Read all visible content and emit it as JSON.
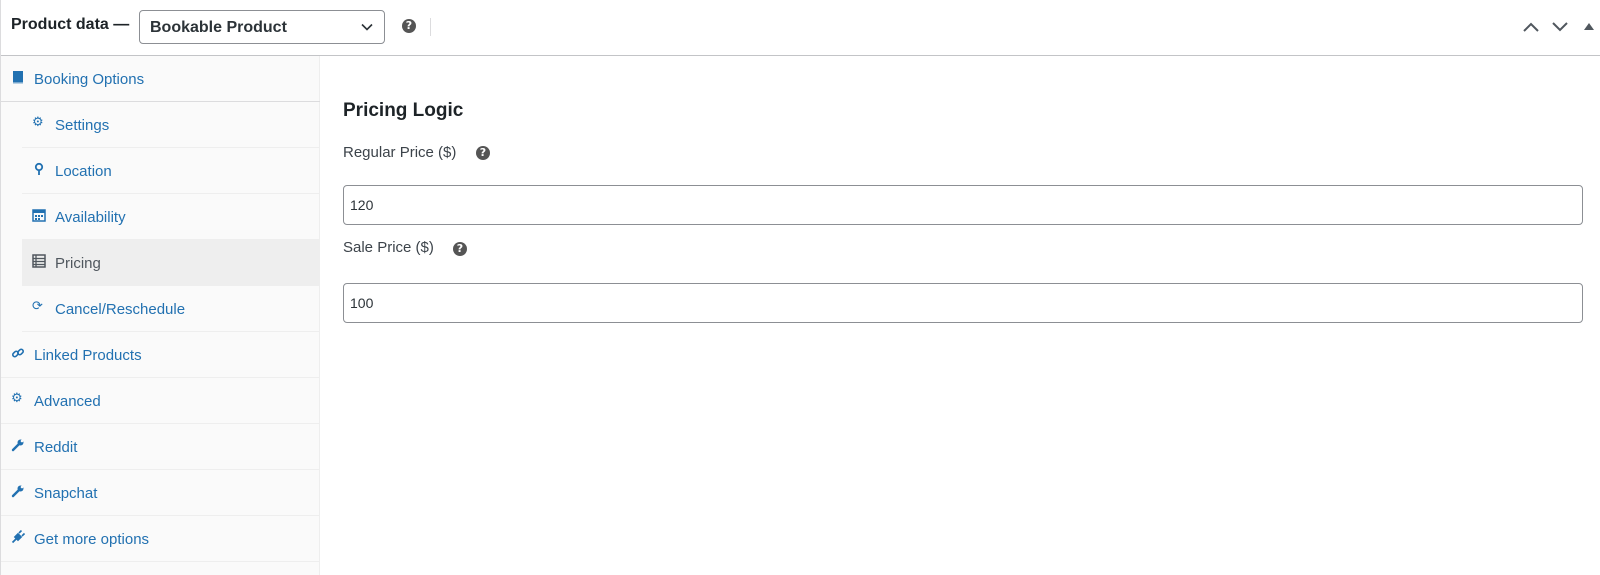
{
  "header": {
    "title": "Product data —",
    "product_type": {
      "selected": "Bookable Product"
    },
    "help_icon": "help-icon",
    "controls": [
      "chevron-up-icon",
      "chevron-down-icon",
      "collapse-arrow-icon"
    ]
  },
  "sidebar": {
    "items": [
      {
        "label": "Booking Options",
        "icon": "book-icon"
      },
      {
        "label": "Settings",
        "icon": "gear-icon"
      },
      {
        "label": "Location",
        "icon": "map-pin-icon"
      },
      {
        "label": "Availability",
        "icon": "calendar-icon"
      },
      {
        "label": "Pricing",
        "icon": "pricing-table-icon",
        "active": true
      },
      {
        "label": "Cancel/Reschedule",
        "icon": "refresh-icon"
      },
      {
        "label": "Linked Products",
        "icon": "link-icon"
      },
      {
        "label": "Advanced",
        "icon": "gear-icon"
      },
      {
        "label": "Reddit",
        "icon": "wrench-icon"
      },
      {
        "label": "Snapchat",
        "icon": "wrench-icon"
      },
      {
        "label": "Get more options",
        "icon": "plugin-icon"
      }
    ]
  },
  "main": {
    "section_title": "Pricing Logic",
    "regular_price": {
      "label": "Regular Price ($)",
      "value": "120"
    },
    "sale_price": {
      "label": "Sale Price ($)",
      "value": "100"
    }
  },
  "colors": {
    "link": "#2271b1",
    "active_bg": "#eeeeee",
    "border": "#8c8f94"
  }
}
